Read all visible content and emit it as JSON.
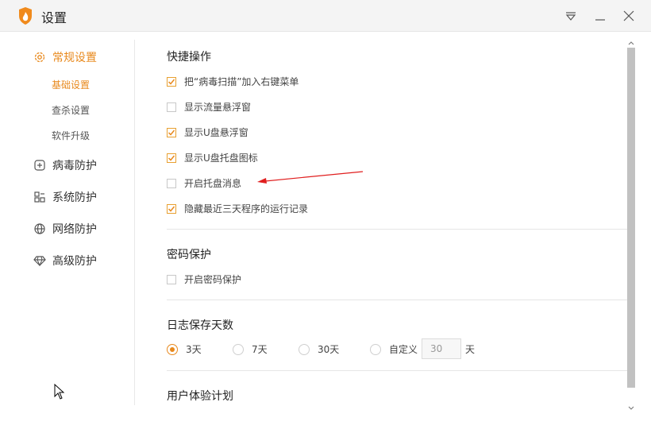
{
  "window": {
    "title": "设置"
  },
  "colors": {
    "accent": "#e8891d",
    "annotation": "#e01e1e"
  },
  "sidebar": {
    "items": [
      {
        "label": "常规设置",
        "icon": "gear-icon",
        "active": true
      },
      {
        "label": "病毒防护",
        "icon": "plus-square-icon"
      },
      {
        "label": "系统防护",
        "icon": "grid-icon"
      },
      {
        "label": "网络防护",
        "icon": "globe-icon"
      },
      {
        "label": "高级防护",
        "icon": "diamond-icon"
      }
    ],
    "subitems": [
      {
        "label": "基础设置",
        "active": true
      },
      {
        "label": "查杀设置"
      },
      {
        "label": "软件升级"
      }
    ]
  },
  "sections": {
    "shortcuts": {
      "title": "快捷操作",
      "options": [
        {
          "label": "把“病毒扫描”加入右键菜单",
          "checked": true
        },
        {
          "label": "显示流量悬浮窗",
          "checked": false
        },
        {
          "label": "显示U盘悬浮窗",
          "checked": true
        },
        {
          "label": "显示U盘托盘图标",
          "checked": true
        },
        {
          "label": "开启托盘消息",
          "checked": false
        },
        {
          "label": "隐藏最近三天程序的运行记录",
          "checked": true
        }
      ]
    },
    "password": {
      "title": "密码保护",
      "options": [
        {
          "label": "开启密码保护",
          "checked": false
        }
      ]
    },
    "log": {
      "title": "日志保存天数",
      "options": [
        {
          "label": "3天",
          "selected": true
        },
        {
          "label": "7天",
          "selected": false
        },
        {
          "label": "30天",
          "selected": false
        },
        {
          "label": "自定义",
          "selected": false
        }
      ],
      "custom_value": "30",
      "unit": "天"
    },
    "ux": {
      "title": "用户体验计划"
    }
  }
}
